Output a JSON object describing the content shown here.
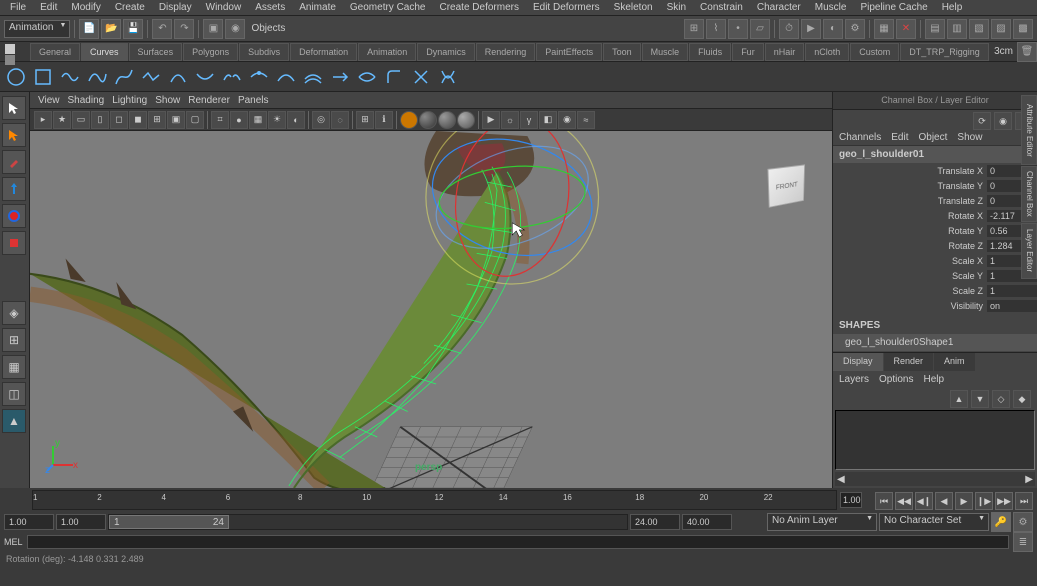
{
  "menu": [
    "File",
    "Edit",
    "Modify",
    "Create",
    "Display",
    "Window",
    "Assets",
    "Animate",
    "Geometry Cache",
    "Create Deformers",
    "Edit Deformers",
    "Skeleton",
    "Skin",
    "Constrain",
    "Character",
    "Muscle",
    "Pipeline Cache",
    "Help"
  ],
  "mode_dropdown": "Animation",
  "objects_label": "Objects",
  "shelf_tabs": [
    "General",
    "Curves",
    "Surfaces",
    "Polygons",
    "Subdivs",
    "Deformation",
    "Animation",
    "Dynamics",
    "Rendering",
    "PaintEffects",
    "Toon",
    "Muscle",
    "Fluids",
    "Fur",
    "nHair",
    "nCloth",
    "Custom",
    "DT_TRP_Rigging"
  ],
  "shelf_active": 1,
  "viewport_menu": [
    "View",
    "Shading",
    "Lighting",
    "Show",
    "Renderer",
    "Panels"
  ],
  "persp": "persp",
  "viewcube_face": "FRONT",
  "panel_title": "Channel Box / Layer Editor",
  "channel_menu": [
    "Channels",
    "Edit",
    "Object",
    "Show"
  ],
  "object_name": "geo_l_shoulder01",
  "attrs": [
    {
      "label": "Translate X",
      "val": "0"
    },
    {
      "label": "Translate Y",
      "val": "0"
    },
    {
      "label": "Translate Z",
      "val": "0"
    },
    {
      "label": "Rotate X",
      "val": "-2.117"
    },
    {
      "label": "Rotate Y",
      "val": "0.56"
    },
    {
      "label": "Rotate Z",
      "val": "1.284"
    },
    {
      "label": "Scale X",
      "val": "1"
    },
    {
      "label": "Scale Y",
      "val": "1"
    },
    {
      "label": "Scale Z",
      "val": "1"
    },
    {
      "label": "Visibility",
      "val": "on"
    }
  ],
  "shapes_header": "SHAPES",
  "shape_name": "geo_l_shoulder0Shape1",
  "layer_tabs": [
    "Display",
    "Render",
    "Anim"
  ],
  "layer_tab_active": 0,
  "layer_menu": [
    "Layers",
    "Options",
    "Help"
  ],
  "side_tabs": [
    "Attribute Editor",
    "Channel Box",
    "Layer Editor"
  ],
  "time_current": "1.00",
  "ticks": [
    {
      "v": "1",
      "p": 0
    },
    {
      "v": "2",
      "p": 13
    },
    {
      "v": "4",
      "p": 26
    },
    {
      "v": "6",
      "p": 39
    },
    {
      "v": "8",
      "p": 52
    },
    {
      "v": "10",
      "p": 64
    },
    {
      "v": "12",
      "p": 77
    },
    {
      "v": "14",
      "p": 90
    },
    {
      "v": "16",
      "p": 103
    },
    {
      "v": "18",
      "p": 116
    },
    {
      "v": "20",
      "p": 129
    },
    {
      "v": "22",
      "p": 142
    }
  ],
  "range_start": "1.00",
  "range_end_inner": "1.00",
  "range_thumb_start": "1",
  "range_thumb_end": "24",
  "range_outer_end": "24.00",
  "range_outer_max": "40.00",
  "anim_layer": "No Anim Layer",
  "char_set": "No Character Set",
  "cmd_label": "MEL",
  "status": "Rotation (deg):  -4.148   0.331   2.489",
  "shelf_right": "3cm"
}
